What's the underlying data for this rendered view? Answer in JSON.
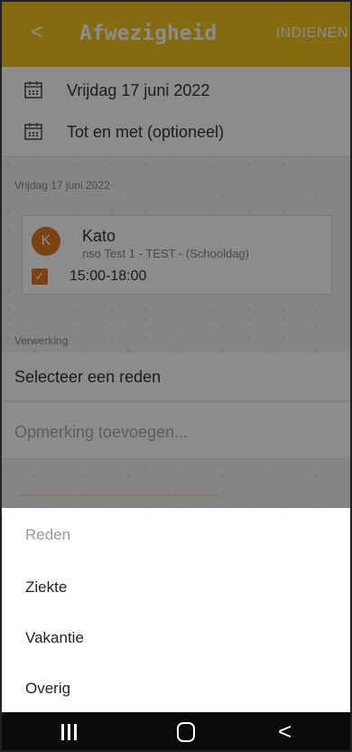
{
  "header": {
    "back_symbol": "<",
    "title": "Afwezigheid",
    "submit_label": "INDIENEN",
    "color": "#f0c419"
  },
  "dates": [
    {
      "label": "Vrijdag 17 juni 2022",
      "icon": "calendar-icon"
    },
    {
      "label": "Tot en met (optioneel)",
      "icon": "calendar-icon"
    }
  ],
  "day_section": {
    "label": "Vrijdag 17 juni 2022"
  },
  "child": {
    "initial": "K",
    "name": "Kato",
    "subtitle": "nso Test 1 - TEST - (Schooldag)",
    "time": "15:00-18:00",
    "checked": true,
    "accent": "#e07a1f"
  },
  "processing": {
    "label": "Verwerking",
    "reason_placeholder": "Selecteer een reden",
    "comment_placeholder": "Opmerking toevoegen..."
  },
  "sheet": {
    "title": "Reden",
    "options": [
      "Ziekte",
      "Vakantie",
      "Overig"
    ]
  },
  "navbar": {
    "recent_icon": "recent-apps-icon",
    "home_icon": "home-icon",
    "back_icon": "back-icon",
    "back_symbol": "<"
  }
}
